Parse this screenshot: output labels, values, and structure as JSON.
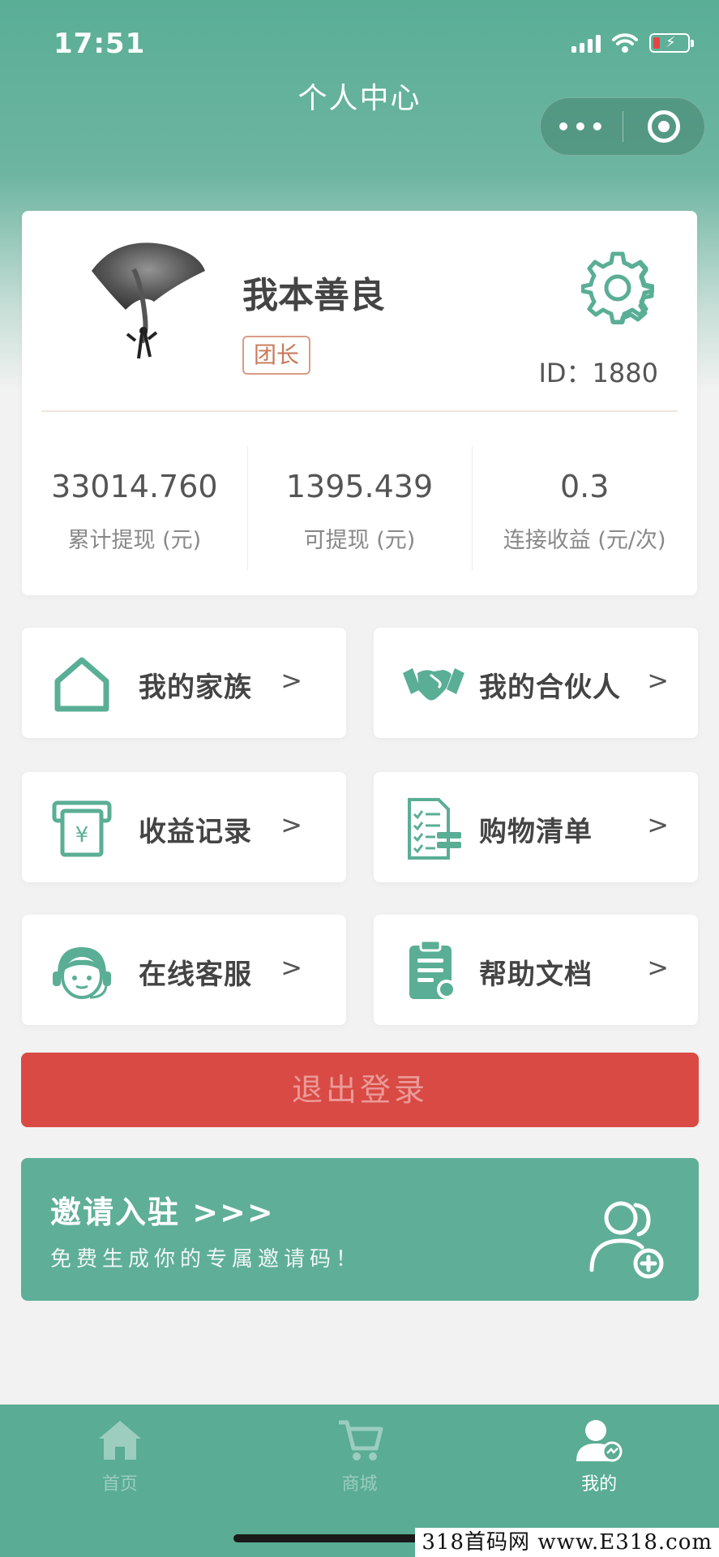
{
  "status": {
    "time": "17:51"
  },
  "nav": {
    "title": "个人中心",
    "more_icon": "more-dots-icon",
    "close_icon": "target-icon"
  },
  "profile": {
    "name": "我本善良",
    "role": "团长",
    "id_text": "ID：1880",
    "stats": [
      {
        "value": "33014.760",
        "label": "累计提现 (元)"
      },
      {
        "value": "1395.439",
        "label": "可提现 (元)"
      },
      {
        "value": "0.3",
        "label": "连接收益 (元/次)"
      }
    ]
  },
  "menu": [
    {
      "label": "我的家族",
      "arrow": ">",
      "icon": "house-icon"
    },
    {
      "label": "我的合伙人",
      "arrow": ">",
      "icon": "handshake-icon"
    },
    {
      "label": "收益记录",
      "arrow": ">",
      "icon": "income-record-icon"
    },
    {
      "label": "购物清单",
      "arrow": ">",
      "icon": "checklist-icon"
    },
    {
      "label": "在线客服",
      "arrow": ">",
      "icon": "headset-icon"
    },
    {
      "label": "帮助文档",
      "arrow": ">",
      "icon": "clipboard-icon"
    }
  ],
  "logout_label": "退出登录",
  "invite": {
    "title": "邀请入驻 >>>",
    "subtitle": "免费生成你的专属邀请码！",
    "icon": "add-users-icon"
  },
  "tabbar": [
    {
      "label": "首页",
      "icon": "home-icon",
      "active": false
    },
    {
      "label": "商城",
      "icon": "cart-icon",
      "active": false
    },
    {
      "label": "我的",
      "icon": "user-icon",
      "active": true
    }
  ],
  "watermark": "318首码网 www.E318.com",
  "colors": {
    "primary": "#5aae96",
    "danger": "#d94a44",
    "badge": "#c77a5a"
  }
}
